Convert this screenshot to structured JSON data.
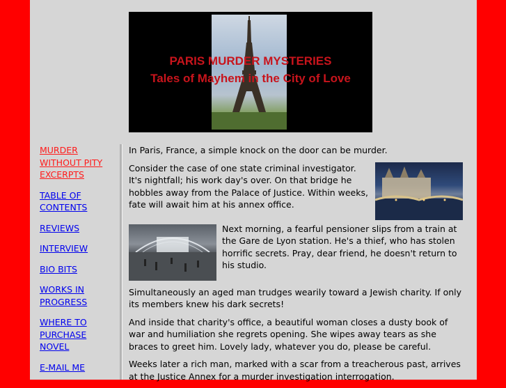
{
  "banner": {
    "title": "PARIS MURDER MYSTERIES",
    "subtitle": "Tales of Mayhem in the City of Love"
  },
  "nav": {
    "items": [
      {
        "label": "MURDER WITHOUT PITY EXCERPTS",
        "active": true
      },
      {
        "label": "TABLE OF CONTENTS"
      },
      {
        "label": "REVIEWS"
      },
      {
        "label": "INTERVIEW"
      },
      {
        "label": "BIO BITS"
      },
      {
        "label": "WORKS IN PROGRESS"
      },
      {
        "label": "WHERE TO PURCHASE NOVEL"
      },
      {
        "label": "E-MAIL ME"
      }
    ]
  },
  "content": {
    "p1": "In Paris, France, a simple knock on the door can be murder.",
    "p2": "Consider the case of one state criminal investigator. It's nightfall; his work day's over. On that bridge he hobbles away from the Palace of Justice. Within weeks, fate will await him at his annex office.",
    "p3": "Next morning, a fearful pensioner slips from a train at the Gare de Lyon station. He's a thief, who has stolen horrific secrets. Pray, dear friend, he doesn't return to his studio.",
    "p4": "Simultaneously an aged man trudges wearily toward a Jewish charity. If only its members knew his dark secrets!",
    "p5": "And inside that charity's office, a beautiful woman closes a dusty book of war and humiliation she regrets opening. She wipes away tears as she braces to greet him. Lovely lady, whatever you do, please be careful.",
    "p6": "Weeks later a rich man, marked with a scar from a treacherous past, arrives at the Justice Annex for a murder investigation interrogation."
  },
  "colors": {
    "frame": "#ff0000",
    "page": "#d6d6d6",
    "link": "#0000ee",
    "active_link": "#ff1a1a",
    "banner_text": "#c8141c"
  },
  "icons": {
    "banner_image": "eiffel-tower-photo",
    "photo1": "palace-of-justice-night-photo",
    "photo2": "gare-de-lyon-station-photo"
  }
}
